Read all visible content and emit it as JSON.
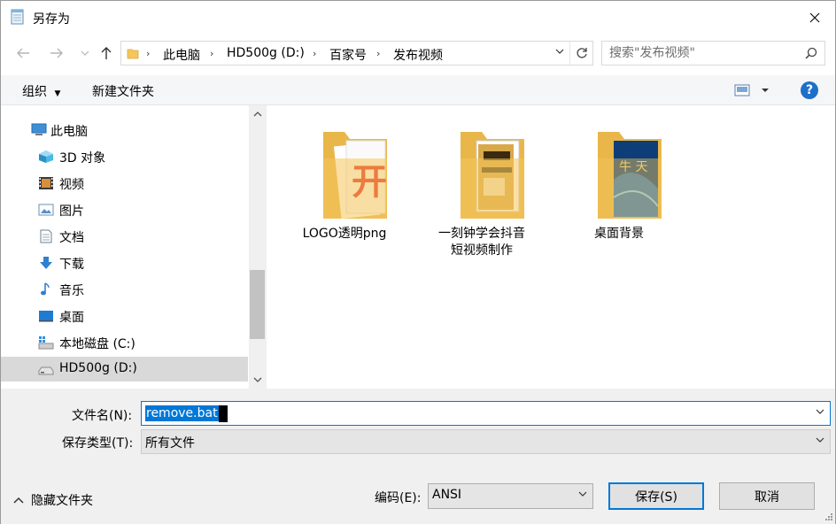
{
  "window": {
    "title": "另存为"
  },
  "address": {
    "breadcrumbs": [
      "此电脑",
      "HD500g (D:)",
      "百家号",
      "发布视频"
    ]
  },
  "search": {
    "placeholder": "搜索\"发布视频\""
  },
  "toolbar": {
    "organize_label": "组织",
    "new_folder_label": "新建文件夹",
    "help_label": "?"
  },
  "sidebar": {
    "items": [
      {
        "label": "此电脑",
        "icon": "computer-icon",
        "selected": false
      },
      {
        "label": "3D 对象",
        "icon": "3d-objects-icon",
        "selected": false
      },
      {
        "label": "视频",
        "icon": "video-icon",
        "selected": false
      },
      {
        "label": "图片",
        "icon": "pictures-icon",
        "selected": false
      },
      {
        "label": "文档",
        "icon": "document-icon",
        "selected": false
      },
      {
        "label": "下载",
        "icon": "download-icon",
        "selected": false
      },
      {
        "label": "音乐",
        "icon": "music-icon",
        "selected": false
      },
      {
        "label": "桌面",
        "icon": "desktop-icon",
        "selected": false
      },
      {
        "label": "本地磁盘 (C:)",
        "icon": "windows-drive-icon",
        "selected": false
      },
      {
        "label": "HD500g (D:)",
        "icon": "drive-icon",
        "selected": true
      }
    ]
  },
  "files": [
    {
      "name": "LOGO透明png",
      "name_line2": "",
      "thumb": "logo-folder-thumbnail"
    },
    {
      "name": "一刻钟学会抖音",
      "name_line2": "短视频制作",
      "thumb": "book-folder-thumbnail"
    },
    {
      "name": "桌面背景",
      "name_line2": "",
      "thumb": "wallpaper-folder-thumbnail"
    }
  ],
  "form": {
    "filename_label": "文件名(N):",
    "filename_value": "remove.bat",
    "filetype_label": "保存类型(T):",
    "filetype_value": "所有文件",
    "hide_folders_label": "隐藏文件夹",
    "encoding_label": "编码(E):",
    "encoding_value": "ANSI",
    "save_label": "保存(S)",
    "cancel_label": "取消"
  },
  "colors": {
    "accent": "#0078d7",
    "selection": "#d9d9d9",
    "folder": "#f5c65b"
  }
}
